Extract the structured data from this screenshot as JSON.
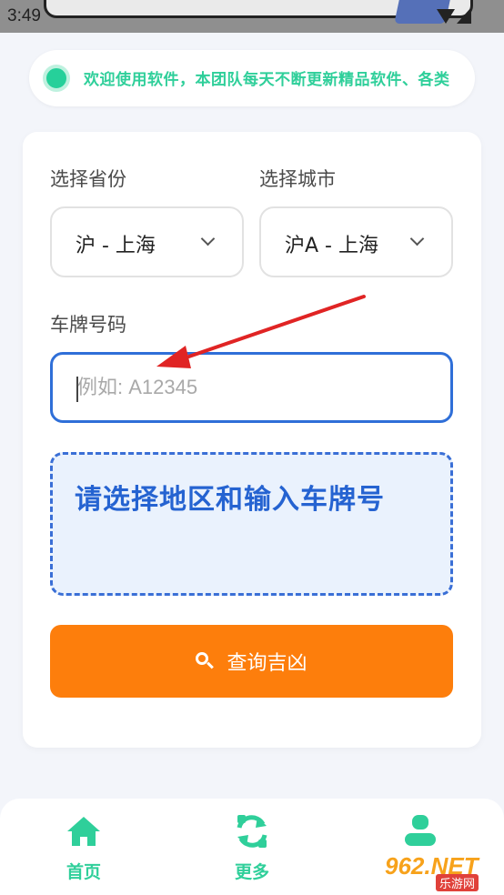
{
  "status_bar": {
    "time": "3:49"
  },
  "notice": {
    "text": "欢迎使用软件，本团队每天不断更新精品软件、各类"
  },
  "form": {
    "province_label": "选择省份",
    "province_value": "沪 - 上海",
    "city_label": "选择城市",
    "city_value": "沪A - 上海",
    "plate_label": "车牌号码",
    "plate_placeholder": "例如: A12345",
    "plate_value": ""
  },
  "result": {
    "text": "请选择地区和输入车牌号"
  },
  "query_button": {
    "label": "查询吉凶"
  },
  "bottom_nav": {
    "items": [
      {
        "label": "首页",
        "icon": "home-icon"
      },
      {
        "label": "更多",
        "icon": "refresh-icon"
      },
      {
        "label": "",
        "icon": "user-icon"
      }
    ]
  },
  "watermark": {
    "brand": "962.NET",
    "sub": "乐游网"
  },
  "colors": {
    "accent_green": "#2fcf9a",
    "accent_blue": "#2f6fd8",
    "button_orange": "#fd7e0c",
    "annotation_red": "#e02424"
  }
}
